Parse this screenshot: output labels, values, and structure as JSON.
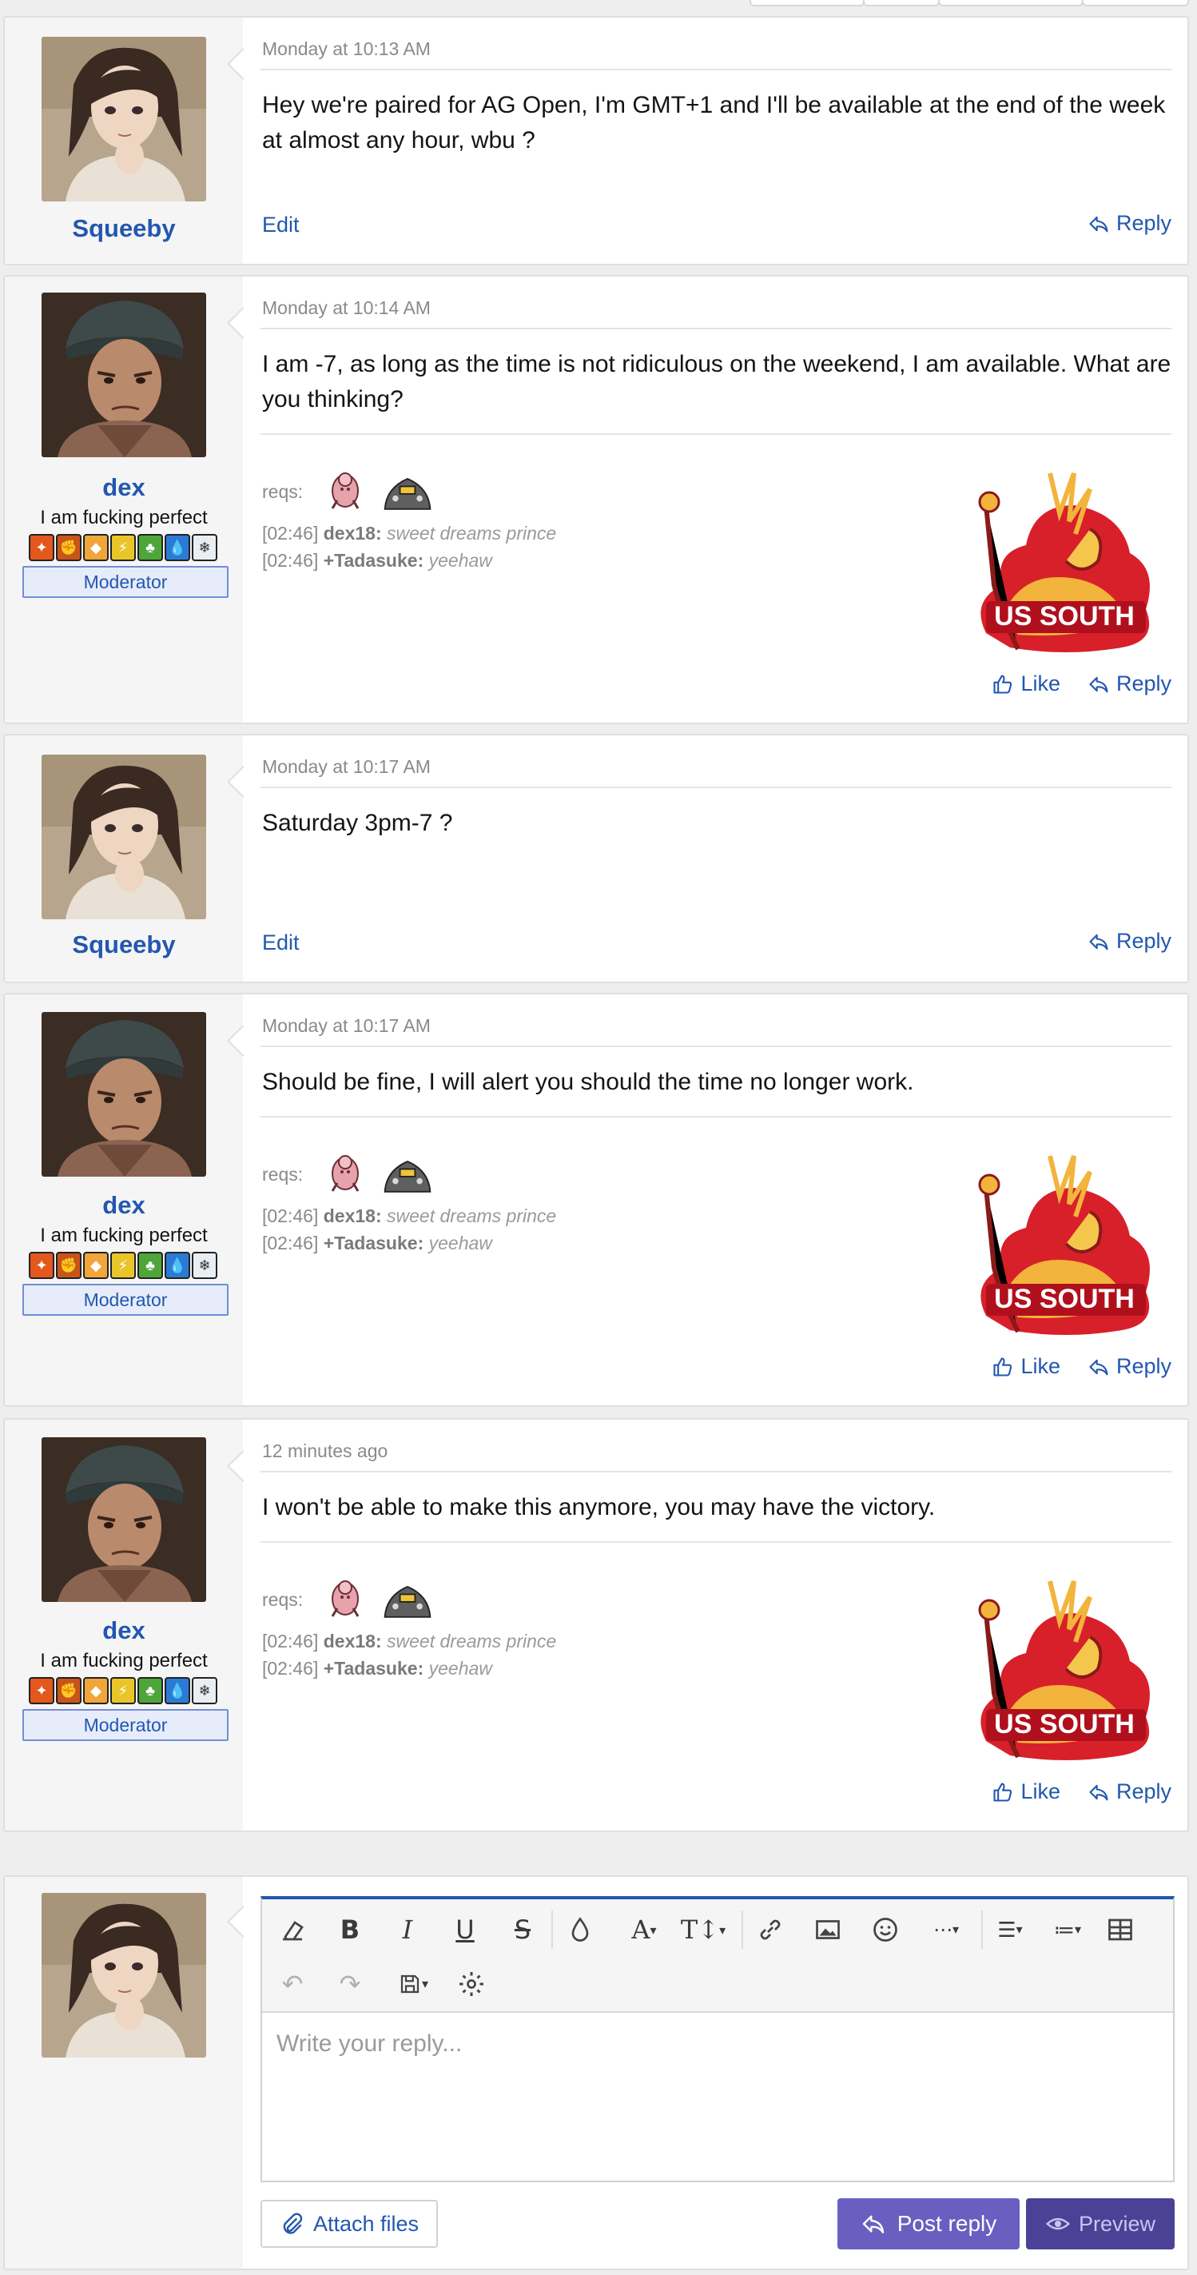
{
  "posts": [
    {
      "author": "Squeeby",
      "date": "Monday at 10:13 AM",
      "message": "Hey we're paired for AG Open, I'm GMT+1 and I'll be available at the end of the week at almost any hour, wbu ?",
      "edit_label": "Edit",
      "reply_label": "Reply"
    },
    {
      "author": "dex",
      "user_title": "I am fucking perfect",
      "banner": "Moderator",
      "date": "Monday at 10:14 AM",
      "message": "I am -7, as long as the time is not ridiculous on the weekend, I am available. What are you thinking?",
      "like_label": "Like",
      "reply_label": "Reply"
    },
    {
      "author": "Squeeby",
      "date": "Monday at 10:17 AM",
      "message": "Saturday 3pm-7 ?",
      "edit_label": "Edit",
      "reply_label": "Reply"
    },
    {
      "author": "dex",
      "user_title": "I am fucking perfect",
      "banner": "Moderator",
      "date": "Monday at 10:17 AM",
      "message": "Should be fine, I will alert you should the time no longer work.",
      "like_label": "Like",
      "reply_label": "Reply"
    },
    {
      "author": "dex",
      "user_title": "I am fucking perfect",
      "banner": "Moderator",
      "date": "12 minutes ago",
      "message": "I won't be able to make this anymore, you may have the victory.",
      "like_label": "Like",
      "reply_label": "Reply"
    }
  ],
  "signature": {
    "reqs_label": "reqs:",
    "line1_time": "[02:46]",
    "line1_user": "dex18:",
    "line1_text": "sweet dreams prince",
    "line2_time": "[02:46]",
    "line2_user": "+Tadasuke:",
    "line2_text": "yeehaw",
    "logo_text": "US SOUTH"
  },
  "badge_icons": [
    "fire-type-icon",
    "fighting-type-icon",
    "ground-type-icon",
    "electric-type-icon",
    "grass-type-icon",
    "water-type-icon",
    "ice-type-icon"
  ],
  "colors": {
    "link": "#2257b0",
    "post_button": "#6a5fc1",
    "preview_button": "#4b4296",
    "editor_accent": "#2257b0"
  },
  "editor": {
    "placeholder": "Write your reply...",
    "attach_label": "Attach files",
    "post_label": "Post reply",
    "preview_label": "Preview"
  }
}
